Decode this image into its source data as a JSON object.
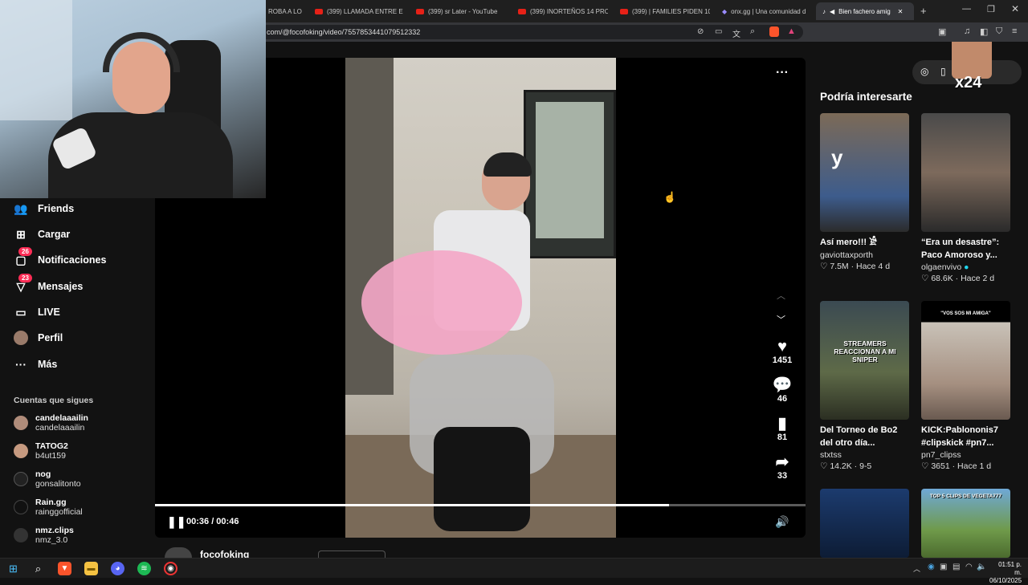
{
  "browser": {
    "tabs": [
      {
        "label": "ROBA A LO"
      },
      {
        "label": "(399) LLAMADA ENTRE EL"
      },
      {
        "label": "(399) sr Later - YouTube"
      },
      {
        "label": "(399) INORTEÑOS 14 PRO"
      },
      {
        "label": "(399) | FAMILIES PIDEN 10"
      },
      {
        "label": "onx.gg | Una comunidad d"
      },
      {
        "label": "Bien fachero amig"
      }
    ],
    "url": "com/@focofoking/video/7557853441079512332"
  },
  "sidebar": {
    "nav": [
      {
        "label": "Friends",
        "icon": "friends-icon"
      },
      {
        "label": "Cargar",
        "icon": "upload-icon"
      },
      {
        "label": "Notificaciones",
        "icon": "inbox-icon",
        "badge": "26"
      },
      {
        "label": "Mensajes",
        "icon": "message-icon",
        "badge": "23"
      },
      {
        "label": "LIVE",
        "icon": "live-icon"
      },
      {
        "label": "Perfil",
        "icon": "profile-icon"
      },
      {
        "label": "Más",
        "icon": "more-icon"
      }
    ],
    "following_title": "Cuentas que sigues",
    "following": [
      {
        "name": "candelaaailin",
        "user": "candelaaailin"
      },
      {
        "name": "TATOG2",
        "user": "b4ut159"
      },
      {
        "name": "nog",
        "user": "gonsalitonto"
      },
      {
        "name": "Rain.gg",
        "user": "rainggofficial"
      },
      {
        "name": "nmz.clips",
        "user": "nmz_3.0"
      }
    ]
  },
  "player": {
    "time": "00:36 / 00:46",
    "progress": 0.79,
    "author": "focofoking",
    "likes": "1451",
    "comments": "46",
    "saves": "81",
    "shares": "33"
  },
  "recommend": {
    "title": "Podría interesarte",
    "overlay": "x24",
    "cards": [
      {
        "title": "Así mero!!! 𓀀",
        "author": "gaviottaxporth",
        "stats": "♡ 7.5M · Hace 4 d",
        "caption": "y"
      },
      {
        "title": "“Era un desastre”: Paco Amoroso y...",
        "author": "olgaenvivo",
        "stats": "♡ 68.6K · Hace 2 d",
        "caption": ""
      },
      {
        "title": "Del Torneo de Bo2 del otro día...",
        "author": "stxtss",
        "stats": "♡ 14.2K · 9-5",
        "caption": "STREAMERS REACCIONAN A MI SNIPER"
      },
      {
        "title": "KICK:Pablononis7 #clipskick #pn7...",
        "author": "pn7_clipss",
        "stats": "♡ 3651 · Hace 1 d",
        "caption": "\"VOS SOS MI AMIGA\""
      },
      {
        "title": "",
        "author": "",
        "stats": "",
        "caption": ""
      },
      {
        "title": "",
        "author": "",
        "stats": "",
        "caption": "TOP 5 CLIPS DE VEGETA777"
      }
    ]
  },
  "taskbar": {
    "time": "01:51 p. m.",
    "date": "06/10/2025"
  }
}
